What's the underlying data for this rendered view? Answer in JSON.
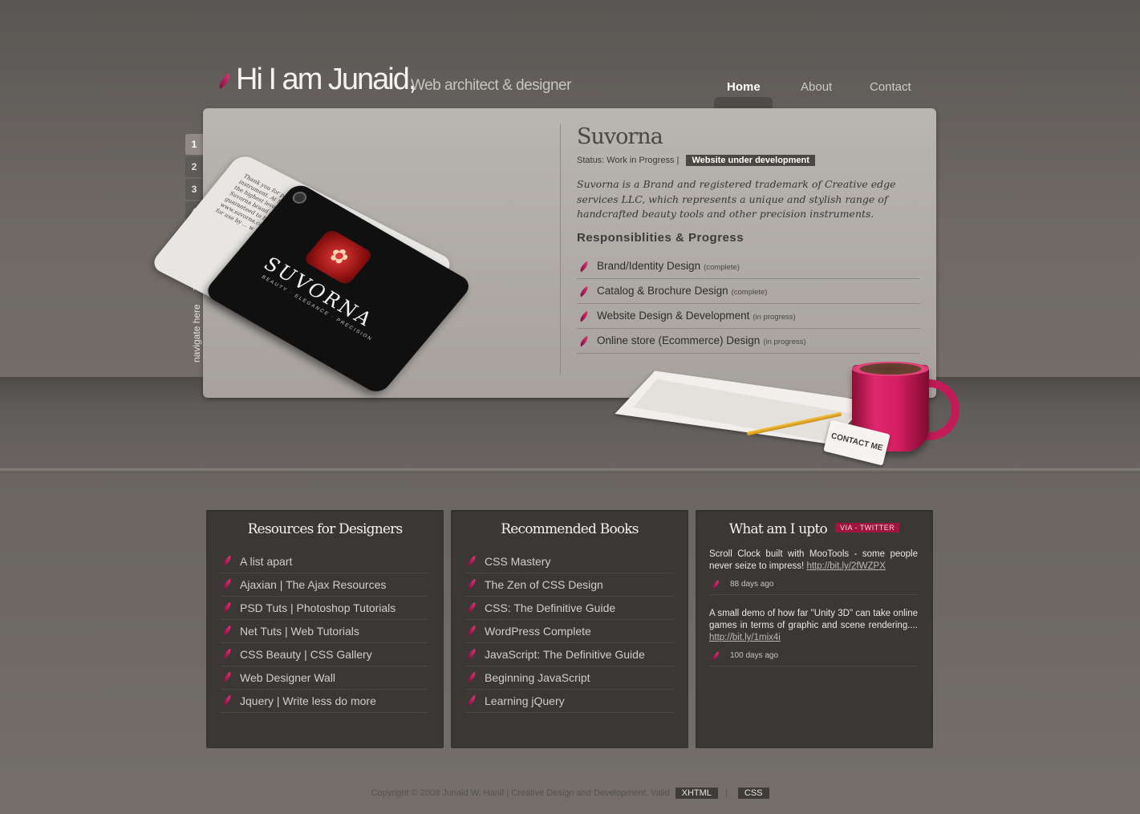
{
  "header": {
    "name": "Hi I am Junaid,",
    "tagline": "Web architect & designer"
  },
  "nav": {
    "items": [
      {
        "label": "Home",
        "active": true
      },
      {
        "label": "About",
        "active": false
      },
      {
        "label": "Contact",
        "active": false
      }
    ]
  },
  "slider": {
    "pages": [
      "1",
      "2",
      "3",
      "4"
    ],
    "active_page": "1",
    "navigate_hint": "navigate here"
  },
  "project": {
    "title": "Suvorna",
    "status_label": "Status: Work in Progress |",
    "status_badge": "Website under development",
    "description": "Suvorna is a Brand and registered trademark of Creative edge services LLC, which represents a unique and stylish range of handcrafted beauty tools and other precision instruments.",
    "responsibilities_title": "Responsiblities & Progress",
    "responsibilities": [
      {
        "label": "Brand/Identity Design",
        "tag": "(complete)"
      },
      {
        "label": "Catalog & Brochure Design",
        "tag": "(complete)"
      },
      {
        "label": "Website Design & Development",
        "tag": "(in progress)"
      },
      {
        "label": "Online store (Ecommerce) Design",
        "tag": "(in progress)"
      }
    ]
  },
  "cards": {
    "white_text": "Thank you for purchasing Suvorna's professional quality instrument. At Suvorna we strive to provide our customers with the highest level of service and the finest quality products. Suvorna brand symbolize ... Each product is handcrafted ... guaranteed to be superior ... For information about ... comments ... www.suvorna.com or visit ... Warning: Keep out of ... not intended for use by ... w w w . s u",
    "brand": "SUVORNA",
    "brand_sub": "BEAUTY · ELEGANCE · PRECISION"
  },
  "contact_card": "CONTACT ME",
  "resources": {
    "title": "Resources for Designers",
    "items": [
      "A list apart",
      "Ajaxian | The Ajax Resources",
      "PSD Tuts | Photoshop Tutorials",
      "Net Tuts | Web Tutorials",
      "CSS Beauty | CSS Gallery",
      "Web Designer Wall",
      "Jquery | Write less do more"
    ]
  },
  "books": {
    "title": "Recommended Books",
    "items": [
      "CSS Mastery",
      "The Zen of CSS Design",
      "CSS: The Definitive Guide",
      "WordPress Complete",
      "JavaScript: The Definitive Guide",
      "Beginning JavaScript",
      "Learning jQuery"
    ]
  },
  "twitter": {
    "title": "What am I upto",
    "badge": "VIA - TWITTER",
    "tweets": [
      {
        "text": "Scroll Clock built with MooTools - some people never seize to impress!",
        "link": "http://bit.ly/2fWZPX",
        "time": "88 days ago"
      },
      {
        "text": "A small demo of how far \"Unity 3D\" can take online games in terms of graphic and scene rendering....",
        "link": "http://bit.ly/1mix4i",
        "time": "100 days ago"
      }
    ]
  },
  "footer": {
    "text": "Copyright © 2008 Junaid W. Hanif | Creative Design and Development. Valid",
    "xhtml": "XHTML",
    "sep": "|",
    "css": "CSS"
  },
  "colors": {
    "accent": "#e6307a",
    "panel_bg": "#3a3735",
    "slider_bg": "#b0aba7"
  }
}
